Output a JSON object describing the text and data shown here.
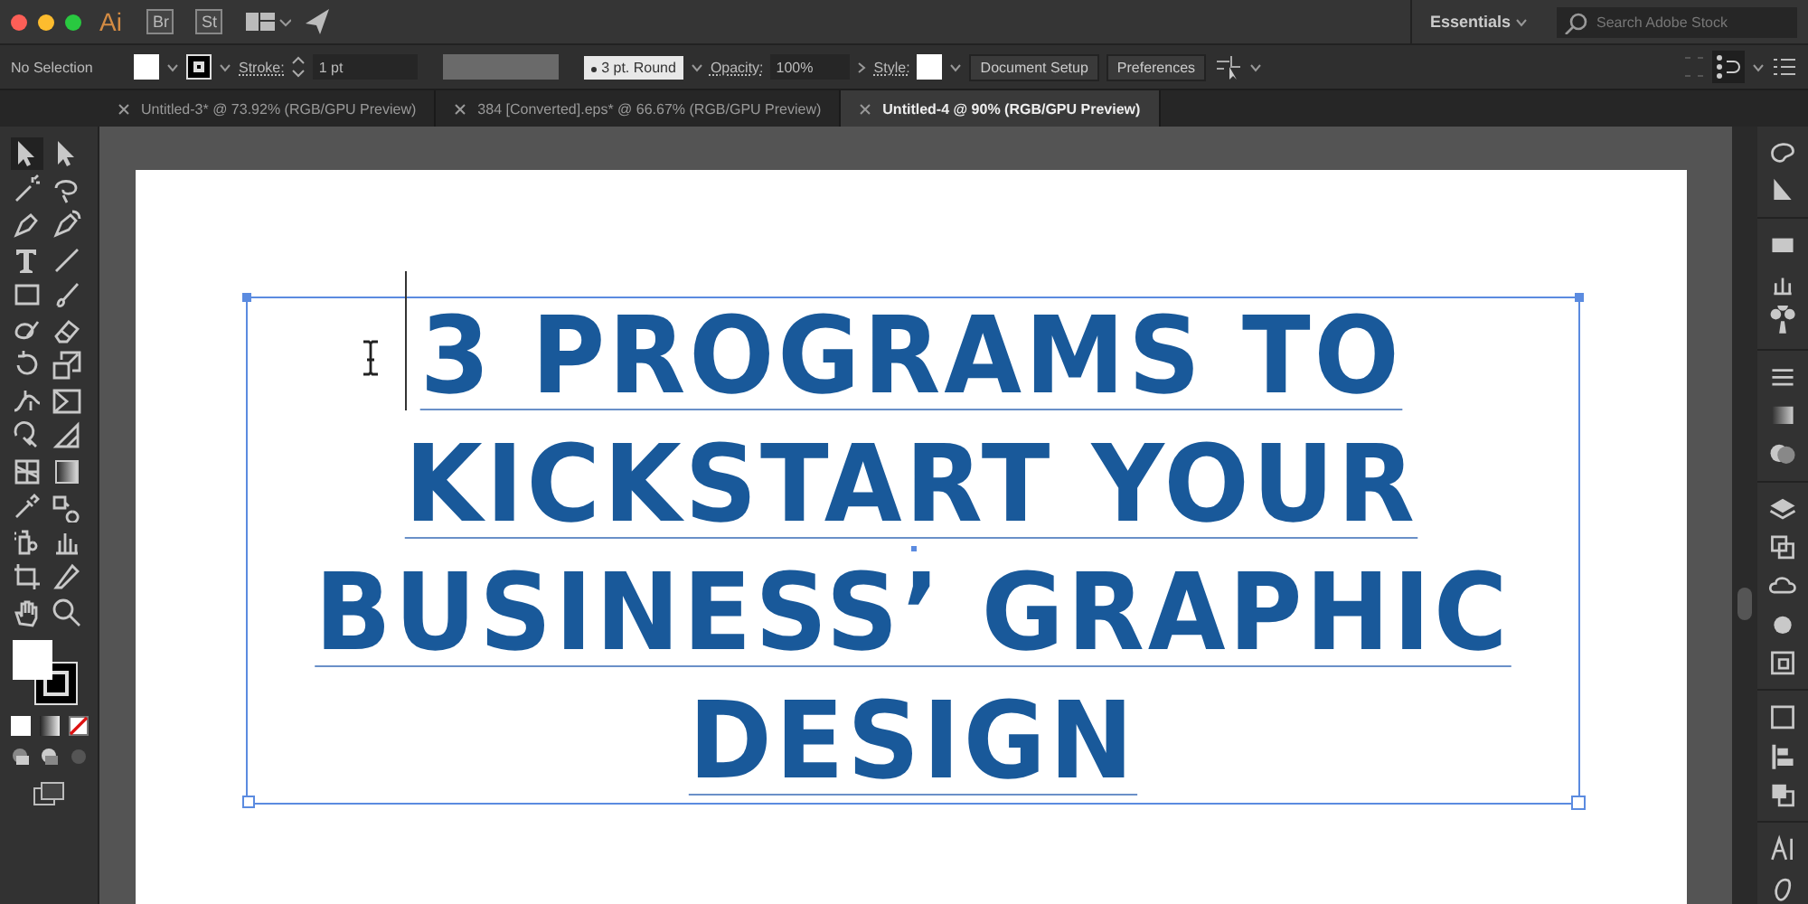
{
  "app_bar": {
    "logo": "Ai",
    "apps": [
      "Br",
      "St"
    ],
    "workspace": "Essentials",
    "search": {
      "placeholder": "Search Adobe Stock"
    }
  },
  "control_bar": {
    "selection": "No Selection",
    "stroke_label": "Stroke:",
    "stroke_weight": "1 pt",
    "brush": "3 pt. Round",
    "opacity_label": "Opacity:",
    "opacity": "100%",
    "style_label": "Style:",
    "buttons": [
      "Document Setup",
      "Preferences"
    ]
  },
  "tabs": [
    {
      "label": "Untitled-3* @ 73.92% (RGB/GPU Preview)",
      "selected": false
    },
    {
      "label": "384 [Converted].eps* @ 66.67% (RGB/GPU Preview)",
      "selected": false
    },
    {
      "label": "Untitled-4 @ 90% (RGB/GPU Preview)",
      "selected": true
    }
  ],
  "artboard": {
    "heading_lines": [
      "3 PROGRAMS TO",
      "KICKSTART YOUR",
      "BUSINESS’ GRAPHIC",
      "DESIGN"
    ],
    "selected": true
  }
}
